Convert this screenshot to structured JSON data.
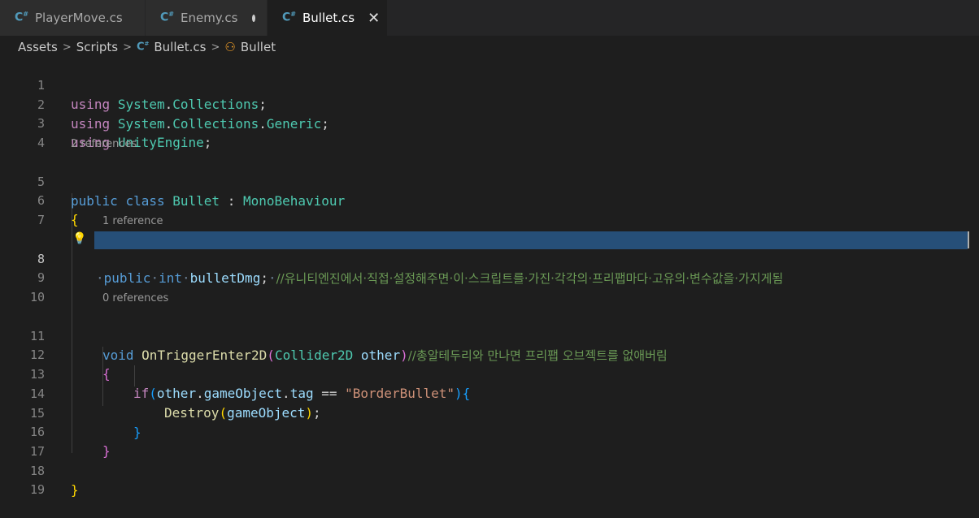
{
  "tabs": [
    {
      "label": "PlayerMove.cs",
      "icon": "csharp-file-icon",
      "state": "normal"
    },
    {
      "label": "Enemy.cs",
      "icon": "csharp-file-icon",
      "state": "modified"
    },
    {
      "label": "Bullet.cs",
      "icon": "csharp-file-icon",
      "state": "active"
    }
  ],
  "tab_close_glyph": "✕",
  "breadcrumb": {
    "items": [
      "Assets",
      "Scripts",
      "Bullet.cs",
      "Bullet"
    ]
  },
  "editor": {
    "active_line": "8",
    "lens": {
      "class_refs": "2 references",
      "field_refs": "1 reference",
      "method_refs": "0 references"
    },
    "line_numbers": [
      "1",
      "2",
      "3",
      "4",
      "5",
      "6",
      "7",
      "8",
      "9",
      "10",
      "11",
      "12",
      "13",
      "14",
      "15",
      "16",
      "17",
      "18",
      "19"
    ],
    "tokens": {
      "using": "using",
      "ns1a": "System",
      "ns1b": "Collections",
      "ns2c": "Generic",
      "ns3": "UnityEngine",
      "public": "public",
      "class": "class",
      "bullet_cls": "Bullet",
      "colon": ":",
      "mono": "MonoBehaviour",
      "int": "int",
      "field": "bulletDmg",
      "comment8": "//유니티엔진에서·직접·설정해주면·이·스크립트를·가진·각각의·프리팹마다·고유의·변수값을·가지게됨",
      "void": "void",
      "method": "OnTriggerEnter2D",
      "param_type": "Collider2D",
      "param": "other",
      "comment11": "//총알테두리와 만나면 프리팹 오브젝트를 없애버림",
      "if": "if",
      "other": "other",
      "gameObject_prop": "gameObject",
      "tag": "tag",
      "eq": "==",
      "str": "\"BorderBullet\"",
      "destroy": "Destroy",
      "gameObject": "gameObject"
    }
  },
  "colors": {
    "background": "#1e1e1e",
    "tab_inactive": "#2d2d2d",
    "selection": "#264f78",
    "keyword": "#569cd6",
    "type": "#4ec9b0",
    "comment": "#6a9955"
  }
}
